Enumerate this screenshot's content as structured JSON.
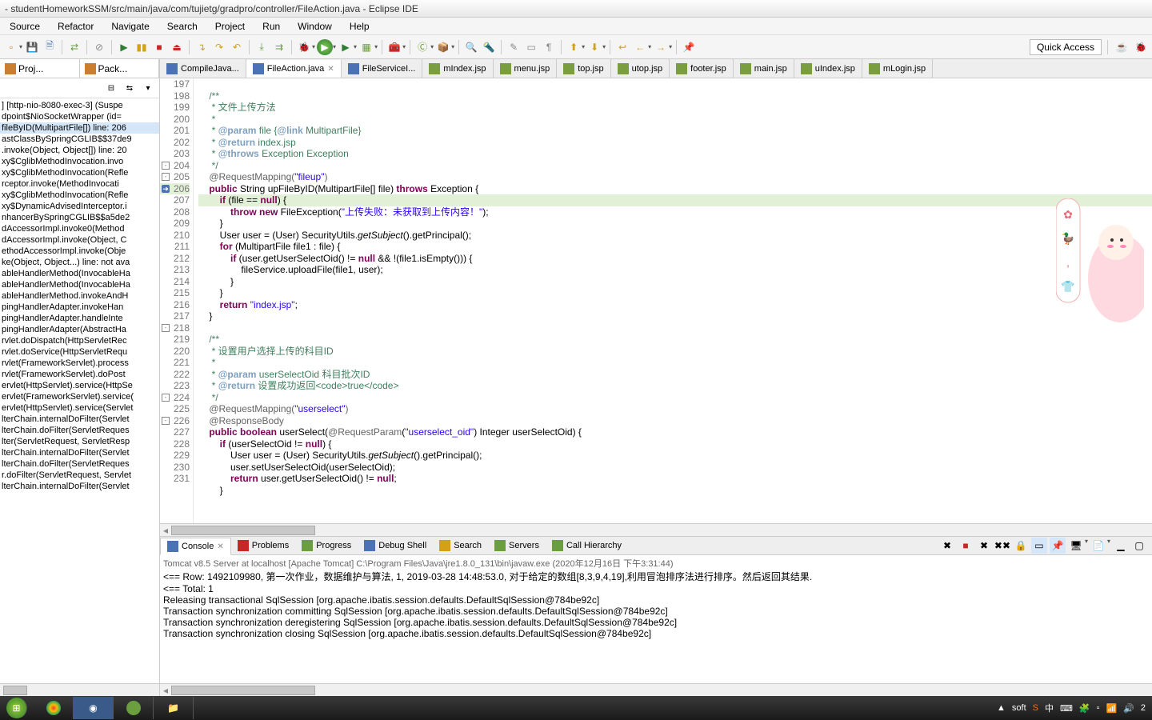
{
  "window": {
    "title": "- studentHomeworkSSM/src/main/java/com/tujietg/gradpro/controller/FileAction.java - Eclipse IDE"
  },
  "menu": [
    "Source",
    "Refactor",
    "Navigate",
    "Search",
    "Project",
    "Run",
    "Window",
    "Help"
  ],
  "quickAccess": "Quick Access",
  "leftViews": {
    "tab1": "Proj...",
    "tab2": "Pack..."
  },
  "stackTrace": [
    "] [http-nio-8080-exec-3] (Suspe",
    "dpoint$NioSocketWrapper  (id=",
    "fileByID(MultipartFile[]) line: 206",
    "astClassBySpringCGLIB$$37de9",
    ".invoke(Object, Object[]) line: 20",
    "xy$CglibMethodInvocation.invo",
    "xy$CglibMethodInvocation(Refle",
    "rceptor.invoke(MethodInvocati",
    "xy$CglibMethodInvocation(Refle",
    "xy$DynamicAdvisedInterceptor.i",
    "nhancerBySpringCGLIB$$a5de2",
    "dAccessorImpl.invoke0(Method",
    "dAccessorImpl.invoke(Object, C",
    "ethodAccessorImpl.invoke(Obje",
    "ke(Object, Object...) line: not ava",
    "ableHandlerMethod(InvocableHa",
    "ableHandlerMethod(InvocableHa",
    "ableHandlerMethod.invokeAndH",
    "pingHandlerAdapter.invokeHan",
    "pingHandlerAdapter.handleInte",
    "pingHandlerAdapter(AbstractHa",
    "rvlet.doDispatch(HttpServletRec",
    "rvlet.doService(HttpServletRequ",
    "rvlet(FrameworkServlet).process",
    "rvlet(FrameworkServlet).doPost",
    "ervlet(HttpServlet).service(HttpSe",
    "ervlet(FrameworkServlet).service(",
    "ervlet(HttpServlet).service(Servlet",
    "lterChain.internalDoFilter(Servlet",
    "lterChain.doFilter(ServletReques",
    "lter(ServletRequest, ServletResp",
    "lterChain.internalDoFilter(Servlet",
    "lterChain.doFilter(ServletReques",
    "r.doFilter(ServletRequest, Servlet",
    "lterChain.internalDoFilter(Servlet"
  ],
  "editorTabs": [
    {
      "label": "CompileJava...",
      "active": false
    },
    {
      "label": "FileAction.java",
      "active": true
    },
    {
      "label": "FileServiceI...",
      "active": false
    },
    {
      "label": "mIndex.jsp",
      "active": false
    },
    {
      "label": "menu.jsp",
      "active": false
    },
    {
      "label": "top.jsp",
      "active": false
    },
    {
      "label": "utop.jsp",
      "active": false
    },
    {
      "label": "footer.jsp",
      "active": false
    },
    {
      "label": "main.jsp",
      "active": false
    },
    {
      "label": "uIndex.jsp",
      "active": false
    },
    {
      "label": "mLogin.jsp",
      "active": false
    }
  ],
  "lineNumbers": [
    "197",
    "198",
    "199",
    "200",
    "201",
    "202",
    "203",
    "204",
    "205",
    "206",
    "207",
    "208",
    "209",
    "210",
    "211",
    "212",
    "213",
    "214",
    "215",
    "216",
    "217",
    "218",
    "219",
    "220",
    "221",
    "222",
    "223",
    "224",
    "225",
    "226",
    "227",
    "228",
    "229",
    "230",
    "231"
  ],
  "code": {
    "l197": "    /**",
    "l198": "     * 文件上传方法",
    "l199": "     *",
    "l200_a": "     * ",
    "l200_b": "@param",
    "l200_c": " file {",
    "l200_d": "@link",
    "l200_e": " MultipartFile}",
    "l201_a": "     * ",
    "l201_b": "@return",
    "l201_c": " index.jsp",
    "l202_a": "     * ",
    "l202_b": "@throws",
    "l202_c": " Exception Exception",
    "l203": "     */",
    "l204_a": "    @RequestMapping(",
    "l204_b": "\"fileup\"",
    "l204_c": ")",
    "l205_a": "    public",
    "l205_b": " String upFileByID(MultipartFile[] file) ",
    "l205_c": "throws",
    "l205_d": " Exception {",
    "l206_a": "        if",
    "l206_b": " (file == ",
    "l206_c": "null",
    "l206_d": ") {",
    "l207_a": "            throw new",
    "l207_b": " FileException(",
    "l207_c": "\"上传失败：未获取到上传内容！\"",
    "l207_d": ");",
    "l208": "        }",
    "l209_a": "        User user = (User) SecurityUtils.",
    "l209_b": "getSubject",
    "l209_c": "().getPrincipal();",
    "l210_a": "        for",
    "l210_b": " (MultipartFile file1 : file) {",
    "l211_a": "            if",
    "l211_b": " (user.getUserSelectOid() != ",
    "l211_c": "null",
    "l211_d": " && !(file1.isEmpty())) {",
    "l212": "                fileService.uploadFile(file1, user);",
    "l213": "            }",
    "l214": "        }",
    "l215_a": "        return ",
    "l215_b": "\"index.jsp\"",
    "l215_c": ";",
    "l216": "    }",
    "l217": "",
    "l218": "    /**",
    "l219": "     * 设置用户选择上传的科目ID",
    "l220": "     *",
    "l221_a": "     * ",
    "l221_b": "@param",
    "l221_c": " userSelectOid 科目批次ID",
    "l222_a": "     * ",
    "l222_b": "@return",
    "l222_c": " 设置成功返回<code>true</code>",
    "l223": "     */",
    "l224_a": "    @RequestMapping(",
    "l224_b": "\"userselect\"",
    "l224_c": ")",
    "l225": "    @ResponseBody",
    "l226_a": "    public boolean",
    "l226_b": " userSelect(",
    "l226_c": "@RequestParam",
    "l226_d": "(",
    "l226_e": "\"userselect_oid\"",
    "l226_f": ") Integer userSelectOid) {",
    "l227_a": "        if",
    "l227_b": " (userSelectOid != ",
    "l227_c": "null",
    "l227_d": ") {",
    "l228_a": "            User user = (User) SecurityUtils.",
    "l228_b": "getSubject",
    "l228_c": "().getPrincipal();",
    "l229": "            user.setUserSelectOid(userSelectOid);",
    "l230_a": "            return",
    "l230_b": " user.getUserSelectOid() != ",
    "l230_c": "null",
    "l230_d": ";",
    "l231": "        }"
  },
  "bottomTabs": [
    "Console",
    "Problems",
    "Progress",
    "Debug Shell",
    "Search",
    "Servers",
    "Call Hierarchy"
  ],
  "console": {
    "title": "Tomcat v8.5 Server at localhost [Apache Tomcat] C:\\Program Files\\Java\\jre1.8.0_131\\bin\\javaw.exe (2020年12月16日 下午3:31:44)",
    "lines": [
      "<==        Row: 1492109980, 第一次作业，数据维护与算法, 1, 2019-03-28 14:48:53.0, 对于给定的数组[8,3,9,4,19],利用冒泡排序法进行排序。然后返回其结果.",
      "<==      Total: 1",
      "Releasing transactional SqlSession [org.apache.ibatis.session.defaults.DefaultSqlSession@784be92c]",
      "Transaction synchronization committing SqlSession [org.apache.ibatis.session.defaults.DefaultSqlSession@784be92c]",
      "Transaction synchronization deregistering SqlSession [org.apache.ibatis.session.defaults.DefaultSqlSession@784be92c]",
      "Transaction synchronization closing SqlSession [org.apache.ibatis.session.defaults.DefaultSqlSession@784be92c]"
    ]
  },
  "tray": {
    "soft": "soft",
    "time": "2"
  }
}
